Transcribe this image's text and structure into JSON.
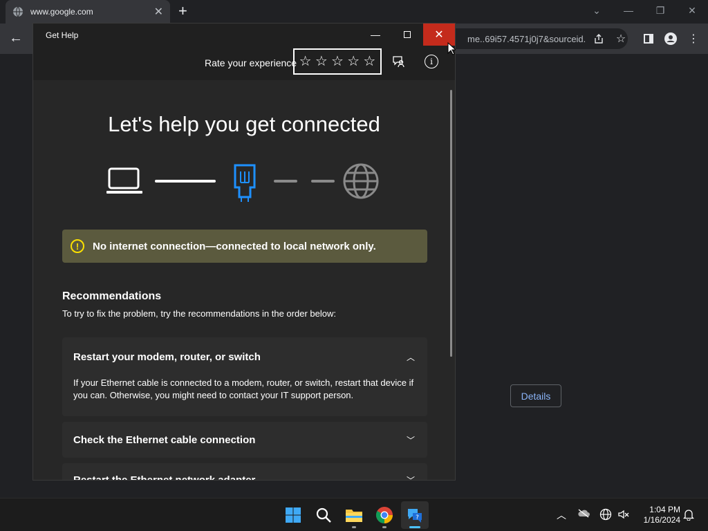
{
  "browser": {
    "tab_title": "www.google.com",
    "tab_close": "✕",
    "new_tab": "+",
    "url_fragment": "me..69i57.4571j0j7&sourceid...",
    "details_button": "Details"
  },
  "dialog": {
    "title": "Get Help",
    "rate_label": "Rate your experience",
    "stars_count": 5,
    "headline": "Let's help you get connected",
    "banner_text": "No internet connection—connected to local network only.",
    "recommendations_title": "Recommendations",
    "recommendations_subtitle": "To try to fix the problem, try the recommendations in the order below:",
    "cards": [
      {
        "title": "Restart your modem, router, or switch",
        "expanded": true,
        "body": "If your Ethernet cable is connected to a modem, router, or switch, restart that device if you can. Otherwise, you might need to contact your IT support person."
      },
      {
        "title": "Check the Ethernet cable connection",
        "expanded": false
      },
      {
        "title": "Restart the Ethernet network adapter",
        "expanded": false
      }
    ]
  },
  "taskbar": {
    "time": "1:04 PM",
    "date": "1/16/2024"
  },
  "colors": {
    "close_red": "#c42b1c",
    "warning_banner": "#5b5a3e",
    "warning_yellow": "#fce100",
    "ethernet_blue": "#1e90ff",
    "link_blue": "#8ab4f8"
  }
}
